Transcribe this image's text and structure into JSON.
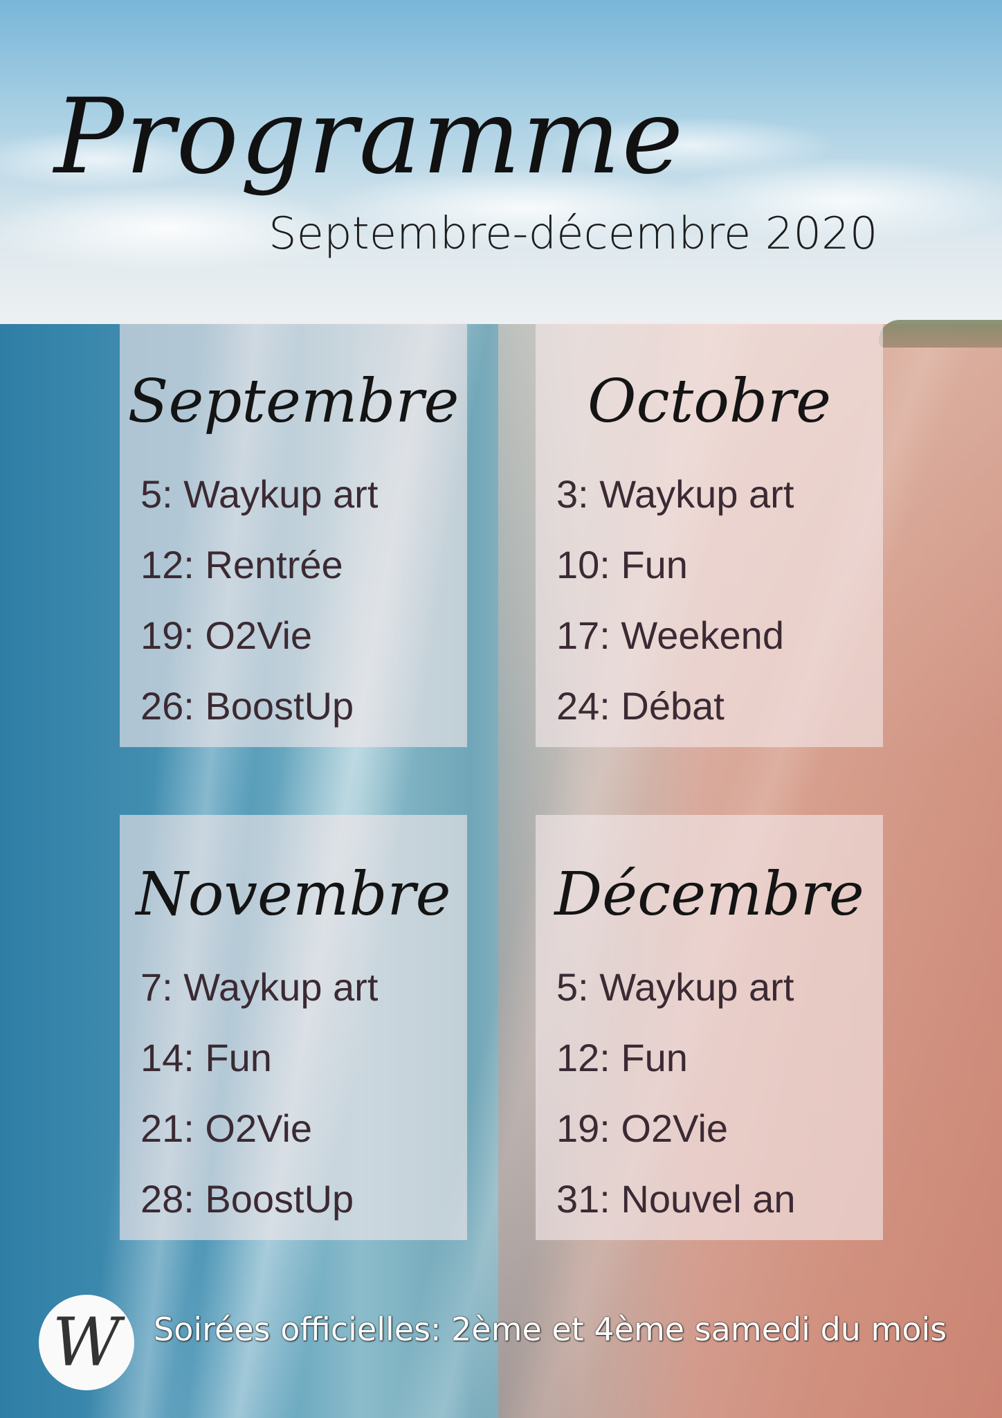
{
  "header": {
    "title": "Programme",
    "subtitle": "Septembre-décembre 2020"
  },
  "months": [
    {
      "name": "Septembre",
      "events": [
        "5: Waykup art",
        "12: Rentrée",
        "19: O2Vie",
        "26: BoostUp"
      ]
    },
    {
      "name": "Octobre",
      "events": [
        "3: Waykup art",
        "10: Fun",
        "17: Weekend",
        "24: Débat"
      ]
    },
    {
      "name": "Novembre",
      "events": [
        "7: Waykup art",
        "14: Fun",
        "21: O2Vie",
        "28: BoostUp"
      ]
    },
    {
      "name": "Décembre",
      "events": [
        "5: Waykup art",
        "12: Fun",
        "19: O2Vie",
        "31: Nouvel an"
      ]
    }
  ],
  "footer": {
    "logo_letter": "W",
    "text": "Soirées officielles: 2ème et 4ème samedi du mois"
  },
  "colors": {
    "title_text": "#111111",
    "card_background": "#f3e8ea",
    "event_text": "#3b2a33",
    "footer_text": "#ffffff"
  }
}
